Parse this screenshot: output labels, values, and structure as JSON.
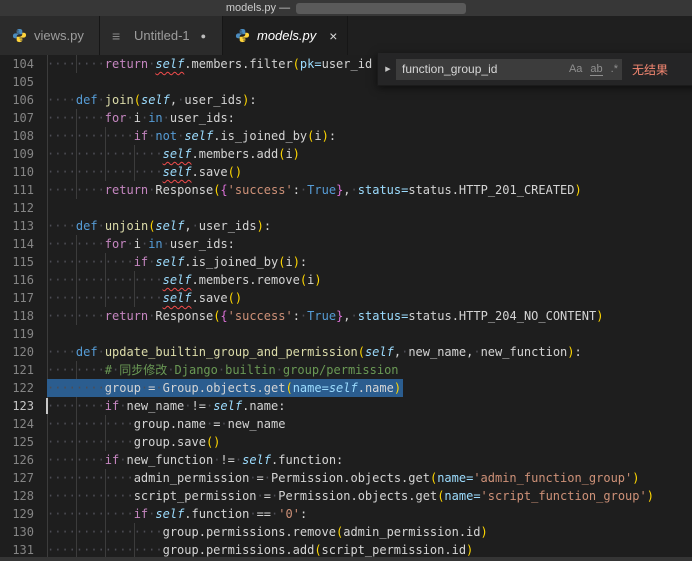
{
  "window": {
    "title": "models.py —"
  },
  "tabs": [
    {
      "label": "views.py",
      "icon": "python-icon",
      "modified": false,
      "active": false
    },
    {
      "label": "Untitled-1",
      "icon": "file-icon",
      "modified": true,
      "active": false,
      "dot": "●"
    },
    {
      "label": "models.py",
      "icon": "python-icon",
      "modified": false,
      "active": true,
      "close_label": "×"
    }
  ],
  "find": {
    "query": "function_group_id",
    "match_case_label": "Aa",
    "whole_word_label": "ab",
    "regex_label": ".*",
    "result_label": "无结果",
    "toggle_label": "▶"
  },
  "colors": {
    "selection": "#2b5d8f",
    "error_squiggle": "#f14c4c",
    "no_results_red": "#f48771",
    "python_blue": "#4B8BBE",
    "python_yellow": "#FFD43B"
  },
  "editor": {
    "first_line": 104,
    "last_line": 131,
    "active_line": 123,
    "selected_line": 122,
    "lines": [
      {
        "n": 104,
        "tk": [
          [
            "        ",
            "ws"
          ],
          [
            "return",
            "kw"
          ],
          [
            " ",
            "ws"
          ],
          [
            "self",
            "sfe"
          ],
          [
            ".members.filter",
            "pl"
          ],
          [
            "(",
            "p1"
          ],
          [
            "pk=",
            "ar"
          ],
          [
            "user_id",
            "pl"
          ]
        ]
      },
      {
        "n": 105,
        "tk": [],
        "bg": 1
      },
      {
        "n": 106,
        "tk": [
          [
            "    ",
            "ws"
          ],
          [
            "def",
            "kb"
          ],
          [
            " ",
            "ws"
          ],
          [
            "join",
            "fn"
          ],
          [
            "(",
            "p1"
          ],
          [
            "self",
            "sf"
          ],
          [
            ",",
            "pl"
          ],
          [
            " ",
            "ws"
          ],
          [
            "user_ids",
            "pl"
          ],
          [
            ")",
            "p1"
          ],
          [
            ":",
            "pl"
          ]
        ]
      },
      {
        "n": 107,
        "tk": [
          [
            "        ",
            "ws"
          ],
          [
            "for",
            "kw"
          ],
          [
            " ",
            "ws"
          ],
          [
            "i",
            "pl"
          ],
          [
            " ",
            "ws"
          ],
          [
            "in",
            "kb"
          ],
          [
            " ",
            "ws"
          ],
          [
            "user_ids",
            "pl"
          ],
          [
            ":",
            "pl"
          ]
        ]
      },
      {
        "n": 108,
        "tk": [
          [
            "            ",
            "ws"
          ],
          [
            "if",
            "kw"
          ],
          [
            " ",
            "ws"
          ],
          [
            "not",
            "kb"
          ],
          [
            " ",
            "ws"
          ],
          [
            "self",
            "sf"
          ],
          [
            ".is_joined_by",
            "pl"
          ],
          [
            "(",
            "p1"
          ],
          [
            "i",
            "pl"
          ],
          [
            ")",
            "p1"
          ],
          [
            ":",
            "pl"
          ]
        ]
      },
      {
        "n": 109,
        "tk": [
          [
            "                ",
            "ws"
          ],
          [
            "self",
            "sfe"
          ],
          [
            ".members.add",
            "pl"
          ],
          [
            "(",
            "p1"
          ],
          [
            "i",
            "pl"
          ],
          [
            ")",
            "p1"
          ]
        ]
      },
      {
        "n": 110,
        "tk": [
          [
            "                ",
            "ws"
          ],
          [
            "self",
            "sfe"
          ],
          [
            ".save",
            "pl"
          ],
          [
            "()",
            "p1"
          ]
        ]
      },
      {
        "n": 111,
        "tk": [
          [
            "        ",
            "ws"
          ],
          [
            "return",
            "kw"
          ],
          [
            " ",
            "ws"
          ],
          [
            "Response",
            "pl"
          ],
          [
            "(",
            "p1"
          ],
          [
            "{",
            "p2"
          ],
          [
            "'success'",
            "st"
          ],
          [
            ":",
            "pl"
          ],
          [
            " ",
            "ws"
          ],
          [
            "True",
            "kb"
          ],
          [
            "}",
            "p2"
          ],
          [
            ",",
            "pl"
          ],
          [
            " ",
            "ws"
          ],
          [
            "status=",
            "ar"
          ],
          [
            "status.HTTP_201_CREATED",
            "pl"
          ],
          [
            ")",
            "p1"
          ]
        ]
      },
      {
        "n": 112,
        "tk": [],
        "bg": 1
      },
      {
        "n": 113,
        "tk": [
          [
            "    ",
            "ws"
          ],
          [
            "def",
            "kb"
          ],
          [
            " ",
            "ws"
          ],
          [
            "unjoin",
            "fn"
          ],
          [
            "(",
            "p1"
          ],
          [
            "self",
            "sf"
          ],
          [
            ",",
            "pl"
          ],
          [
            " ",
            "ws"
          ],
          [
            "user_ids",
            "pl"
          ],
          [
            ")",
            "p1"
          ],
          [
            ":",
            "pl"
          ]
        ]
      },
      {
        "n": 114,
        "tk": [
          [
            "        ",
            "ws"
          ],
          [
            "for",
            "kw"
          ],
          [
            " ",
            "ws"
          ],
          [
            "i",
            "pl"
          ],
          [
            " ",
            "ws"
          ],
          [
            "in",
            "kb"
          ],
          [
            " ",
            "ws"
          ],
          [
            "user_ids",
            "pl"
          ],
          [
            ":",
            "pl"
          ]
        ]
      },
      {
        "n": 115,
        "tk": [
          [
            "            ",
            "ws"
          ],
          [
            "if",
            "kw"
          ],
          [
            " ",
            "ws"
          ],
          [
            "self",
            "sf"
          ],
          [
            ".is_joined_by",
            "pl"
          ],
          [
            "(",
            "p1"
          ],
          [
            "i",
            "pl"
          ],
          [
            ")",
            "p1"
          ],
          [
            ":",
            "pl"
          ]
        ]
      },
      {
        "n": 116,
        "tk": [
          [
            "                ",
            "ws"
          ],
          [
            "self",
            "sfe"
          ],
          [
            ".members.remove",
            "pl"
          ],
          [
            "(",
            "p1"
          ],
          [
            "i",
            "pl"
          ],
          [
            ")",
            "p1"
          ]
        ]
      },
      {
        "n": 117,
        "tk": [
          [
            "                ",
            "ws"
          ],
          [
            "self",
            "sfe"
          ],
          [
            ".save",
            "pl"
          ],
          [
            "()",
            "p1"
          ]
        ]
      },
      {
        "n": 118,
        "tk": [
          [
            "        ",
            "ws"
          ],
          [
            "return",
            "kw"
          ],
          [
            " ",
            "ws"
          ],
          [
            "Response",
            "pl"
          ],
          [
            "(",
            "p1"
          ],
          [
            "{",
            "p2"
          ],
          [
            "'success'",
            "st"
          ],
          [
            ":",
            "pl"
          ],
          [
            " ",
            "ws"
          ],
          [
            "True",
            "kb"
          ],
          [
            "}",
            "p2"
          ],
          [
            ",",
            "pl"
          ],
          [
            " ",
            "ws"
          ],
          [
            "status=",
            "ar"
          ],
          [
            "status.HTTP_204_NO_CONTENT",
            "pl"
          ],
          [
            ")",
            "p1"
          ]
        ]
      },
      {
        "n": 119,
        "tk": [],
        "bg": 1
      },
      {
        "n": 120,
        "tk": [
          [
            "    ",
            "ws"
          ],
          [
            "def",
            "kb"
          ],
          [
            " ",
            "ws"
          ],
          [
            "update_builtin_group_and_permission",
            "fn"
          ],
          [
            "(",
            "p1"
          ],
          [
            "self",
            "sf"
          ],
          [
            ",",
            "pl"
          ],
          [
            " ",
            "ws"
          ],
          [
            "new_name",
            "pl"
          ],
          [
            ",",
            "pl"
          ],
          [
            " ",
            "ws"
          ],
          [
            "new_function",
            "pl"
          ],
          [
            ")",
            "p1"
          ],
          [
            ":",
            "pl"
          ]
        ]
      },
      {
        "n": 121,
        "tk": [
          [
            "        ",
            "ws"
          ],
          [
            "#",
            "cm"
          ],
          [
            " ",
            "ws"
          ],
          [
            "同步修改",
            "cm"
          ],
          [
            " ",
            "ws"
          ],
          [
            "Django",
            "cm"
          ],
          [
            " ",
            "ws"
          ],
          [
            "builtin",
            "cm"
          ],
          [
            " ",
            "ws"
          ],
          [
            "group/permission",
            "cm"
          ]
        ]
      },
      {
        "n": 122,
        "sel": true,
        "tk": [
          [
            "        ",
            "ws"
          ],
          [
            "group",
            "pl"
          ],
          [
            " ",
            "ws"
          ],
          [
            "=",
            "pl"
          ],
          [
            " ",
            "ws"
          ],
          [
            "Group.objects.get",
            "pl"
          ],
          [
            "(",
            "p1"
          ],
          [
            "name=",
            "ar"
          ],
          [
            "self",
            "sf"
          ],
          [
            ".name",
            "pl"
          ],
          [
            ")",
            "p1"
          ]
        ]
      },
      {
        "n": 123,
        "cur": true,
        "tk": [
          [
            "        ",
            "ws"
          ],
          [
            "if",
            "kw"
          ],
          [
            " ",
            "ws"
          ],
          [
            "new_name",
            "pl"
          ],
          [
            " ",
            "ws"
          ],
          [
            "!=",
            "pl"
          ],
          [
            " ",
            "ws"
          ],
          [
            "self",
            "sf"
          ],
          [
            ".name",
            "pl"
          ],
          [
            ":",
            "pl"
          ]
        ]
      },
      {
        "n": 124,
        "tk": [
          [
            "            ",
            "ws"
          ],
          [
            "group.name",
            "pl"
          ],
          [
            " ",
            "ws"
          ],
          [
            "=",
            "pl"
          ],
          [
            " ",
            "ws"
          ],
          [
            "new_name",
            "pl"
          ]
        ]
      },
      {
        "n": 125,
        "tk": [
          [
            "            ",
            "ws"
          ],
          [
            "group.save",
            "pl"
          ],
          [
            "()",
            "p1"
          ]
        ]
      },
      {
        "n": 126,
        "tk": [
          [
            "        ",
            "ws"
          ],
          [
            "if",
            "kw"
          ],
          [
            " ",
            "ws"
          ],
          [
            "new_function",
            "pl"
          ],
          [
            " ",
            "ws"
          ],
          [
            "!=",
            "pl"
          ],
          [
            " ",
            "ws"
          ],
          [
            "self",
            "sf"
          ],
          [
            ".function",
            "pl"
          ],
          [
            ":",
            "pl"
          ]
        ]
      },
      {
        "n": 127,
        "tk": [
          [
            "            ",
            "ws"
          ],
          [
            "admin_permission",
            "pl"
          ],
          [
            " ",
            "ws"
          ],
          [
            "=",
            "pl"
          ],
          [
            " ",
            "ws"
          ],
          [
            "Permission.objects.get",
            "pl"
          ],
          [
            "(",
            "p1"
          ],
          [
            "name=",
            "ar"
          ],
          [
            "'admin_function_group'",
            "st"
          ],
          [
            ")",
            "p1"
          ]
        ]
      },
      {
        "n": 128,
        "tk": [
          [
            "            ",
            "ws"
          ],
          [
            "script_permission",
            "pl"
          ],
          [
            " ",
            "ws"
          ],
          [
            "=",
            "pl"
          ],
          [
            " ",
            "ws"
          ],
          [
            "Permission.objects.get",
            "pl"
          ],
          [
            "(",
            "p1"
          ],
          [
            "name=",
            "ar"
          ],
          [
            "'script_function_group'",
            "st"
          ],
          [
            ")",
            "p1"
          ]
        ]
      },
      {
        "n": 129,
        "tk": [
          [
            "            ",
            "ws"
          ],
          [
            "if",
            "kw"
          ],
          [
            " ",
            "ws"
          ],
          [
            "self",
            "sf"
          ],
          [
            ".function",
            "pl"
          ],
          [
            " ",
            "ws"
          ],
          [
            "==",
            "pl"
          ],
          [
            " ",
            "ws"
          ],
          [
            "'0'",
            "st"
          ],
          [
            ":",
            "pl"
          ]
        ]
      },
      {
        "n": 130,
        "tk": [
          [
            "                ",
            "ws"
          ],
          [
            "group.permissions.remove",
            "pl"
          ],
          [
            "(",
            "p1"
          ],
          [
            "admin_permission.id",
            "pl"
          ],
          [
            ")",
            "p1"
          ]
        ]
      },
      {
        "n": 131,
        "tk": [
          [
            "                ",
            "ws"
          ],
          [
            "group.permissions.add",
            "pl"
          ],
          [
            "(",
            "p1"
          ],
          [
            "script_permission.id",
            "pl"
          ],
          [
            ")",
            "p1"
          ]
        ]
      }
    ]
  }
}
